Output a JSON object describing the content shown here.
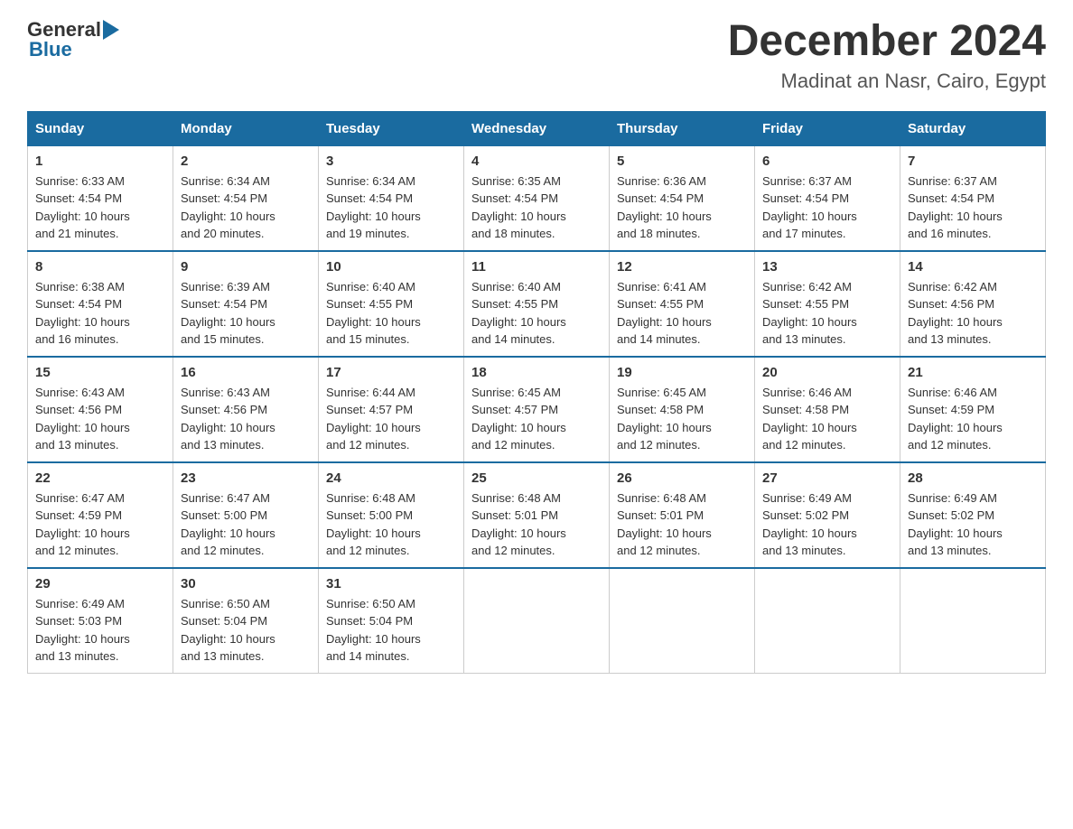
{
  "header": {
    "logo_general": "General",
    "logo_blue": "Blue",
    "title": "December 2024",
    "subtitle": "Madinat an Nasr, Cairo, Egypt"
  },
  "calendar": {
    "days_of_week": [
      "Sunday",
      "Monday",
      "Tuesday",
      "Wednesday",
      "Thursday",
      "Friday",
      "Saturday"
    ],
    "weeks": [
      [
        {
          "day": "1",
          "sunrise": "6:33 AM",
          "sunset": "4:54 PM",
          "daylight": "10 hours and 21 minutes."
        },
        {
          "day": "2",
          "sunrise": "6:34 AM",
          "sunset": "4:54 PM",
          "daylight": "10 hours and 20 minutes."
        },
        {
          "day": "3",
          "sunrise": "6:34 AM",
          "sunset": "4:54 PM",
          "daylight": "10 hours and 19 minutes."
        },
        {
          "day": "4",
          "sunrise": "6:35 AM",
          "sunset": "4:54 PM",
          "daylight": "10 hours and 18 minutes."
        },
        {
          "day": "5",
          "sunrise": "6:36 AM",
          "sunset": "4:54 PM",
          "daylight": "10 hours and 18 minutes."
        },
        {
          "day": "6",
          "sunrise": "6:37 AM",
          "sunset": "4:54 PM",
          "daylight": "10 hours and 17 minutes."
        },
        {
          "day": "7",
          "sunrise": "6:37 AM",
          "sunset": "4:54 PM",
          "daylight": "10 hours and 16 minutes."
        }
      ],
      [
        {
          "day": "8",
          "sunrise": "6:38 AM",
          "sunset": "4:54 PM",
          "daylight": "10 hours and 16 minutes."
        },
        {
          "day": "9",
          "sunrise": "6:39 AM",
          "sunset": "4:54 PM",
          "daylight": "10 hours and 15 minutes."
        },
        {
          "day": "10",
          "sunrise": "6:40 AM",
          "sunset": "4:55 PM",
          "daylight": "10 hours and 15 minutes."
        },
        {
          "day": "11",
          "sunrise": "6:40 AM",
          "sunset": "4:55 PM",
          "daylight": "10 hours and 14 minutes."
        },
        {
          "day": "12",
          "sunrise": "6:41 AM",
          "sunset": "4:55 PM",
          "daylight": "10 hours and 14 minutes."
        },
        {
          "day": "13",
          "sunrise": "6:42 AM",
          "sunset": "4:55 PM",
          "daylight": "10 hours and 13 minutes."
        },
        {
          "day": "14",
          "sunrise": "6:42 AM",
          "sunset": "4:56 PM",
          "daylight": "10 hours and 13 minutes."
        }
      ],
      [
        {
          "day": "15",
          "sunrise": "6:43 AM",
          "sunset": "4:56 PM",
          "daylight": "10 hours and 13 minutes."
        },
        {
          "day": "16",
          "sunrise": "6:43 AM",
          "sunset": "4:56 PM",
          "daylight": "10 hours and 13 minutes."
        },
        {
          "day": "17",
          "sunrise": "6:44 AM",
          "sunset": "4:57 PM",
          "daylight": "10 hours and 12 minutes."
        },
        {
          "day": "18",
          "sunrise": "6:45 AM",
          "sunset": "4:57 PM",
          "daylight": "10 hours and 12 minutes."
        },
        {
          "day": "19",
          "sunrise": "6:45 AM",
          "sunset": "4:58 PM",
          "daylight": "10 hours and 12 minutes."
        },
        {
          "day": "20",
          "sunrise": "6:46 AM",
          "sunset": "4:58 PM",
          "daylight": "10 hours and 12 minutes."
        },
        {
          "day": "21",
          "sunrise": "6:46 AM",
          "sunset": "4:59 PM",
          "daylight": "10 hours and 12 minutes."
        }
      ],
      [
        {
          "day": "22",
          "sunrise": "6:47 AM",
          "sunset": "4:59 PM",
          "daylight": "10 hours and 12 minutes."
        },
        {
          "day": "23",
          "sunrise": "6:47 AM",
          "sunset": "5:00 PM",
          "daylight": "10 hours and 12 minutes."
        },
        {
          "day": "24",
          "sunrise": "6:48 AM",
          "sunset": "5:00 PM",
          "daylight": "10 hours and 12 minutes."
        },
        {
          "day": "25",
          "sunrise": "6:48 AM",
          "sunset": "5:01 PM",
          "daylight": "10 hours and 12 minutes."
        },
        {
          "day": "26",
          "sunrise": "6:48 AM",
          "sunset": "5:01 PM",
          "daylight": "10 hours and 12 minutes."
        },
        {
          "day": "27",
          "sunrise": "6:49 AM",
          "sunset": "5:02 PM",
          "daylight": "10 hours and 13 minutes."
        },
        {
          "day": "28",
          "sunrise": "6:49 AM",
          "sunset": "5:02 PM",
          "daylight": "10 hours and 13 minutes."
        }
      ],
      [
        {
          "day": "29",
          "sunrise": "6:49 AM",
          "sunset": "5:03 PM",
          "daylight": "10 hours and 13 minutes."
        },
        {
          "day": "30",
          "sunrise": "6:50 AM",
          "sunset": "5:04 PM",
          "daylight": "10 hours and 13 minutes."
        },
        {
          "day": "31",
          "sunrise": "6:50 AM",
          "sunset": "5:04 PM",
          "daylight": "10 hours and 14 minutes."
        },
        null,
        null,
        null,
        null
      ]
    ],
    "labels": {
      "sunrise": "Sunrise:",
      "sunset": "Sunset:",
      "daylight": "Daylight:"
    }
  }
}
